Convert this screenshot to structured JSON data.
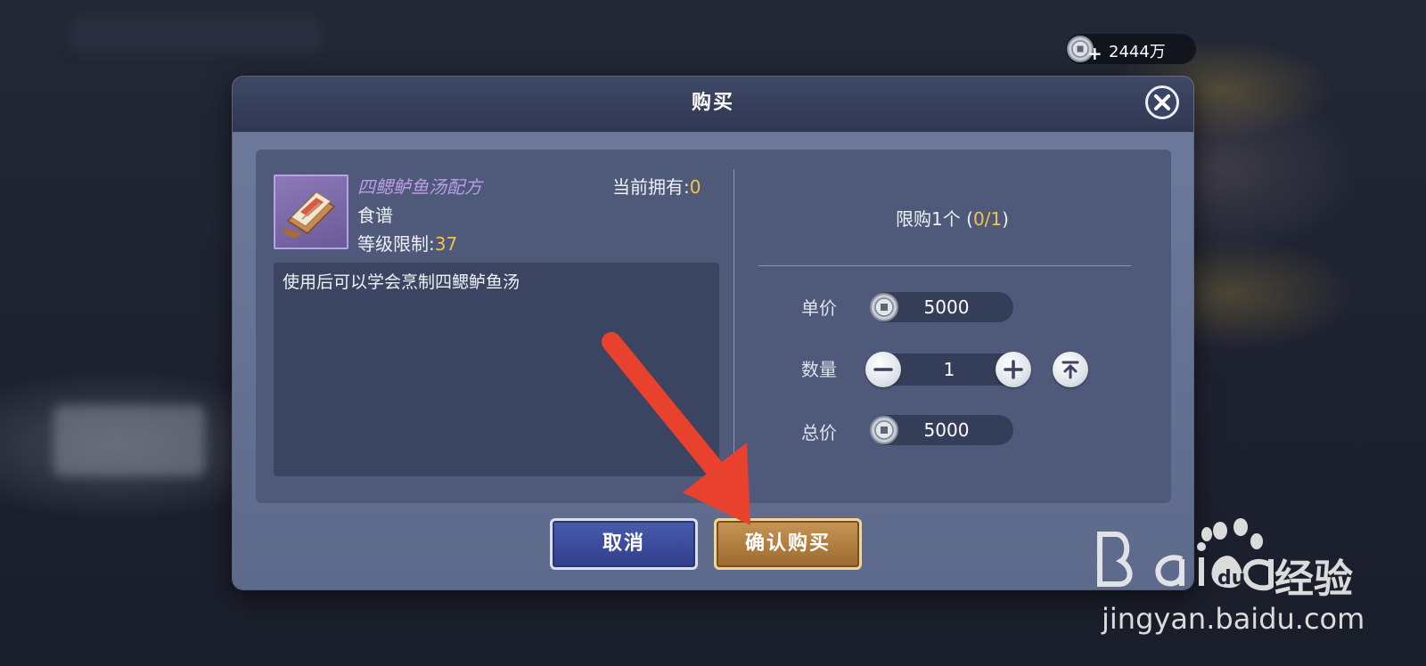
{
  "currency": {
    "amount": "2444万",
    "plus": "+"
  },
  "dialog": {
    "title": "购买",
    "item": {
      "name": "四鳃鲈鱼汤配方",
      "owned_label": "当前拥有:",
      "owned_value": "0",
      "type": "食谱",
      "level_label": "等级限制:",
      "level_value": "37",
      "description": "使用后可以学会烹制四鳃鲈鱼汤"
    },
    "limit": {
      "prefix": "限购1个 (",
      "value": "0/1",
      "suffix": ")"
    },
    "unit_price": {
      "label": "单价",
      "value": "5000"
    },
    "quantity": {
      "label": "数量",
      "value": "1"
    },
    "total_price": {
      "label": "总价",
      "value": "5000"
    },
    "buttons": {
      "cancel": "取消",
      "confirm": "确认购买"
    }
  },
  "watermark": {
    "brand_cn": "经验",
    "url": "jingyan.baidu.com"
  },
  "colors": {
    "accent_gold": "#f1c24d",
    "item_name_purple": "#b99ce6",
    "arrow_red": "#e8412e"
  }
}
